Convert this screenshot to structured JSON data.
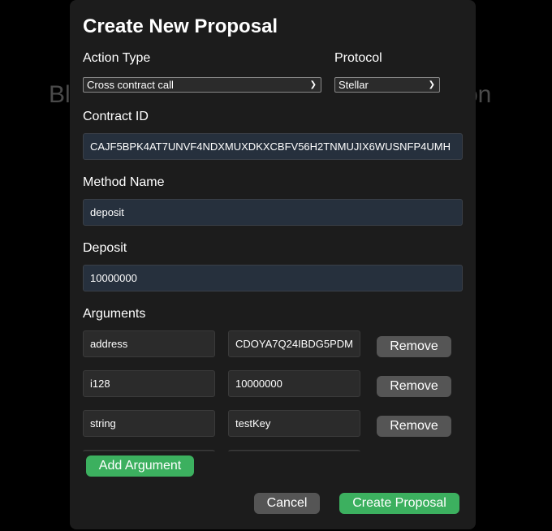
{
  "background": {
    "left_fragment": "Bl",
    "right_fragment": "on"
  },
  "modal": {
    "title": "Create New Proposal",
    "action_type": {
      "label": "Action Type",
      "value": "Cross contract call"
    },
    "protocol": {
      "label": "Protocol",
      "value": "Stellar"
    },
    "contract_id": {
      "label": "Contract ID",
      "value": "CAJF5BPK4AT7UNVF4NDXMUXDKXCBFV56H2TNMUJIX6WUSNFP4UMH"
    },
    "method_name": {
      "label": "Method Name",
      "value": "deposit"
    },
    "deposit": {
      "label": "Deposit",
      "value": "10000000"
    },
    "arguments": {
      "label": "Arguments",
      "rows": [
        {
          "type": "address",
          "value": "CDOYA7Q24IBDG5PDM"
        },
        {
          "type": "i128",
          "value": "10000000"
        },
        {
          "type": "string",
          "value": "testKey"
        },
        {
          "type": "",
          "value": ""
        }
      ],
      "remove_label": "Remove",
      "add_label": "Add Argument"
    },
    "cancel_label": "Cancel",
    "submit_label": "Create Proposal"
  },
  "colors": {
    "accent": "#3cb05f",
    "secondary": "#555555"
  }
}
